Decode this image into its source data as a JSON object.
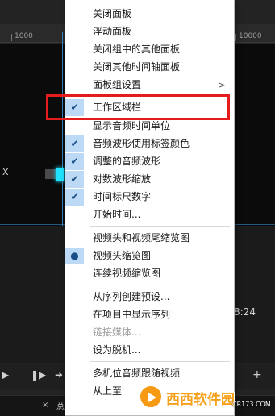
{
  "background": {
    "ruler_left": "1000",
    "ruler_right": "10000",
    "clip_label": "X",
    "timecode": "8:24",
    "tab_close": "×",
    "tab_text": "总 ≡"
  },
  "menu": {
    "items": [
      {
        "label": "关闭面板",
        "state": "none"
      },
      {
        "label": "浮动面板",
        "state": "none"
      },
      {
        "label": "关闭组中的其他面板",
        "state": "none"
      },
      {
        "label": "关闭其他时间轴面板",
        "state": "none"
      },
      {
        "label": "面板组设置",
        "state": "none",
        "submenu": true,
        "arrow": ">"
      },
      {
        "label": "工作区域栏",
        "state": "check",
        "highlighted": true
      },
      {
        "label": "显示音频时间单位",
        "state": "none"
      },
      {
        "label": "音频波形使用标签颜色",
        "state": "check"
      },
      {
        "label": "调整的音频波形",
        "state": "check"
      },
      {
        "label": "对数波形缩放",
        "state": "check"
      },
      {
        "label": "时间标尺数字",
        "state": "check"
      },
      {
        "label": "开始时间...",
        "state": "none"
      },
      {
        "label": "视频头和视频尾缩览图",
        "state": "none"
      },
      {
        "label": "视频头缩览图",
        "state": "radio"
      },
      {
        "label": "连续视频缩览图",
        "state": "none"
      },
      {
        "label": "从序列创建预设...",
        "state": "none"
      },
      {
        "label": "在项目中显示序列",
        "state": "none"
      },
      {
        "label": "链接媒体...",
        "state": "none",
        "disabled": true
      },
      {
        "label": "设为脱机...",
        "state": "none"
      },
      {
        "label": "多机位音频跟随视频",
        "state": "none"
      },
      {
        "label": "从上至",
        "state": "none"
      }
    ],
    "check_glyph": "✔",
    "radio_glyph": "●"
  },
  "watermark": {
    "text": "西西软件园",
    "domain": "CR173.COM"
  },
  "colors": {
    "highlight_box": "#e51c1c",
    "check_column": "#bcdaf5",
    "playhead": "#3d8fd6",
    "cyan_marker": "#1fe3ff",
    "watermark_orange": "#f59a12"
  }
}
